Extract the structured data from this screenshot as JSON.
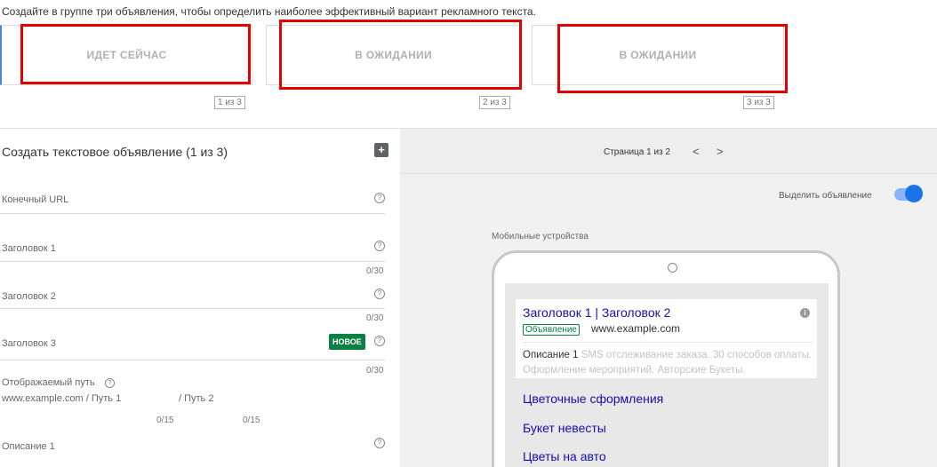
{
  "instruction": "Создайте в группе три объявления, чтобы определить наиболее эффективный вариант рекламного текста.",
  "variants": [
    {
      "status": "ИДЕТ СЕЙЧАС",
      "counter": "1 из 3"
    },
    {
      "status": "В ОЖИДАНИИ",
      "counter": "2 из 3"
    },
    {
      "status": "В ОЖИДАНИИ",
      "counter": "3 из 3"
    }
  ],
  "form": {
    "title": "Создать текстовое объявление (1 из 3)",
    "final_url_label": "Конечный URL",
    "headline1_label": "Заголовок 1",
    "headline1_count": "0/30",
    "headline2_label": "Заголовок 2",
    "headline2_count": "0/30",
    "headline3_label": "Заголовок 3",
    "headline3_badge": "НОВОЕ",
    "headline3_count": "0/30",
    "display_path_label": "Отображаемый путь",
    "display_path_domain": "www.example.com / Путь 1",
    "display_path_sep": "/ Путь 2",
    "path1_count": "0/15",
    "path2_count": "0/15",
    "description1_label": "Описание 1"
  },
  "preview": {
    "pager_text": "Страница 1 из 2",
    "highlight_label": "Выделить объявление",
    "highlight_on": true,
    "device_label": "Мобильные устройства",
    "ad": {
      "headline": "Заголовок 1 | Заголовок 2",
      "badge": "Объявление",
      "url": "www.example.com",
      "desc_prefix": "Описание 1",
      "desc_rest": " SMS отслеживание заказа. 30 способов оплаты. Оформление мероприятий. Авторские Букеты."
    },
    "sitelinks": [
      "Цветочные сформления",
      "Букет невесты",
      "Цветы на авто"
    ]
  },
  "colors": {
    "accent": "#1a73e8",
    "annotation_red": "#e20000",
    "link": "#1a0dab",
    "badge_green": "#0b8043"
  }
}
